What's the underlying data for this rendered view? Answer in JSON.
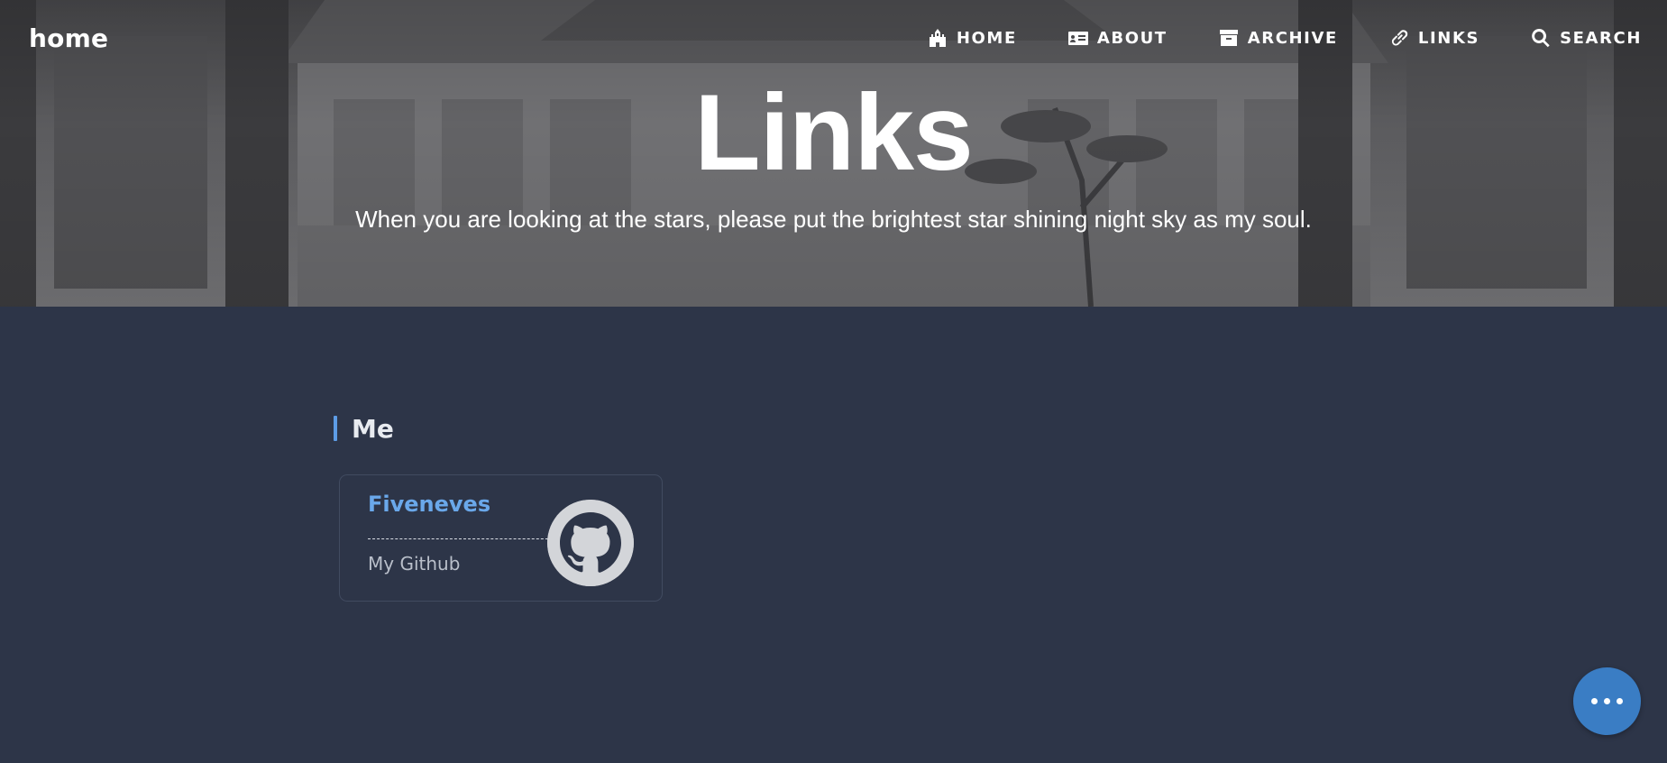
{
  "header": {
    "brand": "home",
    "nav": [
      {
        "label": "HOME",
        "icon": "castle-icon"
      },
      {
        "label": "ABOUT",
        "icon": "id-card-icon"
      },
      {
        "label": "ARCHIVE",
        "icon": "archive-box-icon"
      },
      {
        "label": "LINKS",
        "icon": "link-icon"
      },
      {
        "label": "SEARCH",
        "icon": "search-icon"
      }
    ],
    "title": "Links",
    "subtitle": "When you are looking at the stars, please put the brightest star shining night sky as my soul."
  },
  "main": {
    "section_title": "Me",
    "links": [
      {
        "name": "Fiveneves",
        "description": "My Github",
        "avatar_icon": "github-icon"
      }
    ]
  },
  "fab": {
    "icon": "more-dots-icon"
  },
  "colors": {
    "background": "#2d3548",
    "accent": "#5d9ce6",
    "link_name": "#6aa8ea",
    "fab": "#3a7dc4"
  }
}
